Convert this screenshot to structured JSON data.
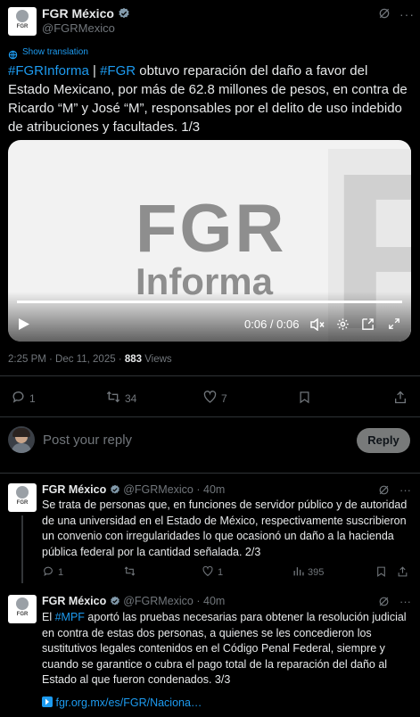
{
  "main": {
    "author_name": "FGR México",
    "handle": "@FGRMexico",
    "avatar_text": "FGR",
    "show_translation": "Show translation",
    "text_hashtag1": "#FGRInforma",
    "text_sep": " | ",
    "text_hashtag2": "#FGR",
    "text_body": " obtuvo reparación del daño a favor del Estado Mexicano, por más de 62.8 millones de pesos, en contra de Ricardo “M” y José “M”, responsables por el delito de uso indebido de atribuciones y facultades. 1/3",
    "video": {
      "line1": "FGR",
      "line2": "Informa",
      "big_letter": "F",
      "time": "0:06 / 0:06",
      "progress": 1.0
    },
    "meta_time": "2:25 PM · Dec 11, 2025 · ",
    "views_count": "883",
    "views_label": " Views",
    "actions": {
      "replies": "1",
      "reposts": "34",
      "likes": "7"
    }
  },
  "composer": {
    "placeholder": "Post your reply",
    "reply_button": "Reply"
  },
  "replies": [
    {
      "author_name": "FGR México",
      "handle_time": "@FGRMexico · 40m",
      "avatar_text": "FGR",
      "text": "Se trata de personas que, en funciones de servidor público y de autoridad de una universidad en el Estado de México, respectivamente suscribieron un convenio con irregularidades lo que ocasionó un daño a la hacienda pública federal por la cantidad señalada. 2/3",
      "actions": {
        "replies": "1",
        "reposts": "",
        "likes": "1",
        "views": "395"
      }
    },
    {
      "author_name": "FGR México",
      "handle_time": "@FGRMexico · 40m",
      "avatar_text": "FGR",
      "text_prefix": "El ",
      "text_hashtag": "#MPF",
      "text_body": " aportó las pruebas necesarias para obtener la resolución judicial en contra de estas dos personas, a quienes se les concedieron los sustitutivos legales contenidos en el Código Penal Federal, siempre y cuando se garantice o cubra el pago total de la reparación del daño al Estado al que fueron condenados. 3/3",
      "link_text": "fgr.org.mx/es/FGR/Naciona…"
    }
  ],
  "colors": {
    "accent": "#1d9bf0",
    "verified": "#829aab",
    "muted": "#71767b",
    "background": "#000000"
  }
}
